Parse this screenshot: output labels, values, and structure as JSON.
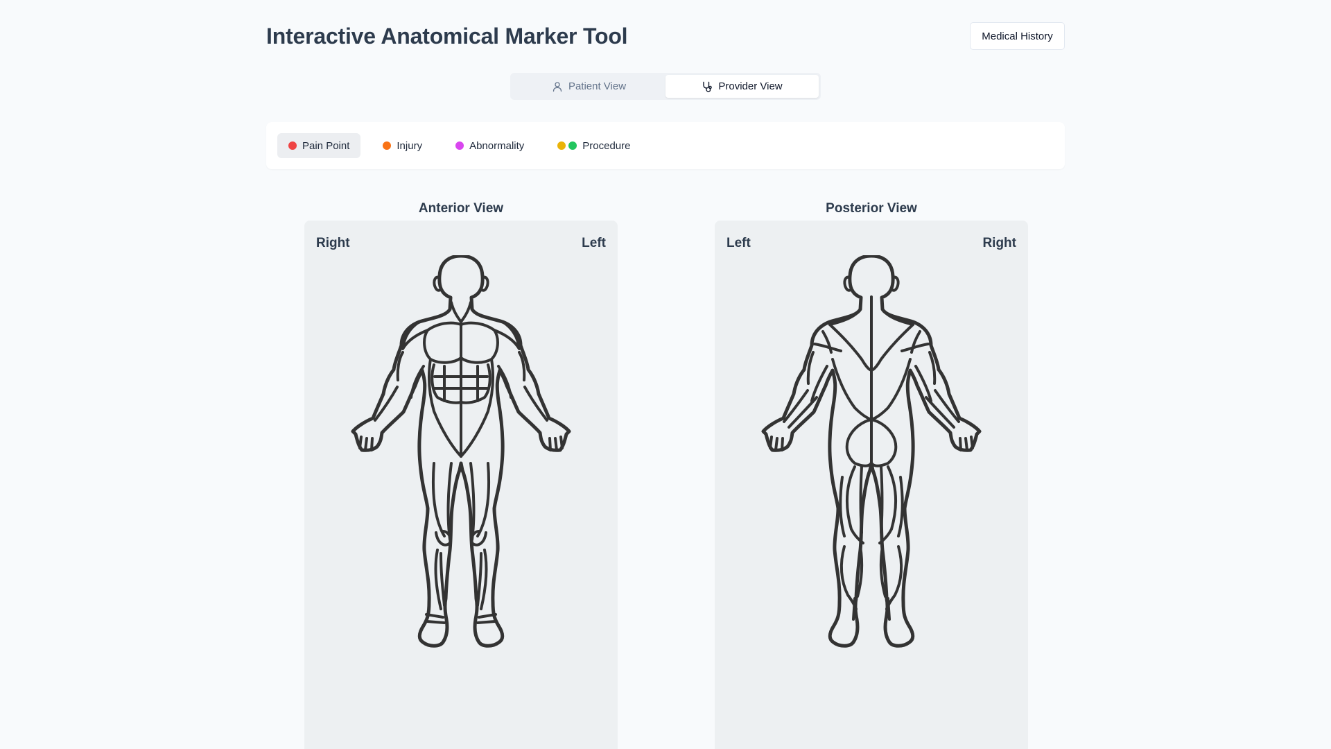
{
  "header": {
    "title": "Interactive Anatomical Marker Tool",
    "history_button": "Medical History"
  },
  "view_toggle": {
    "options": [
      {
        "label": "Patient View",
        "icon": "user-icon",
        "active": false
      },
      {
        "label": "Provider View",
        "icon": "stethoscope-icon",
        "active": true
      }
    ]
  },
  "marker_types": [
    {
      "label": "Pain Point",
      "colors": [
        "#ef4444"
      ],
      "active": true
    },
    {
      "label": "Injury",
      "colors": [
        "#f97316"
      ],
      "active": false
    },
    {
      "label": "Abnormality",
      "colors": [
        "#d946ef"
      ],
      "active": false
    },
    {
      "label": "Procedure",
      "colors": [
        "#eab308",
        "#22c55e"
      ],
      "active": false
    }
  ],
  "views": {
    "anterior": {
      "title": "Anterior View",
      "left_label": "Right",
      "right_label": "Left"
    },
    "posterior": {
      "title": "Posterior View",
      "left_label": "Left",
      "right_label": "Right"
    }
  },
  "colors": {
    "background": "#f8fafc",
    "canvas": "#edf0f2",
    "outline": "#333333"
  }
}
